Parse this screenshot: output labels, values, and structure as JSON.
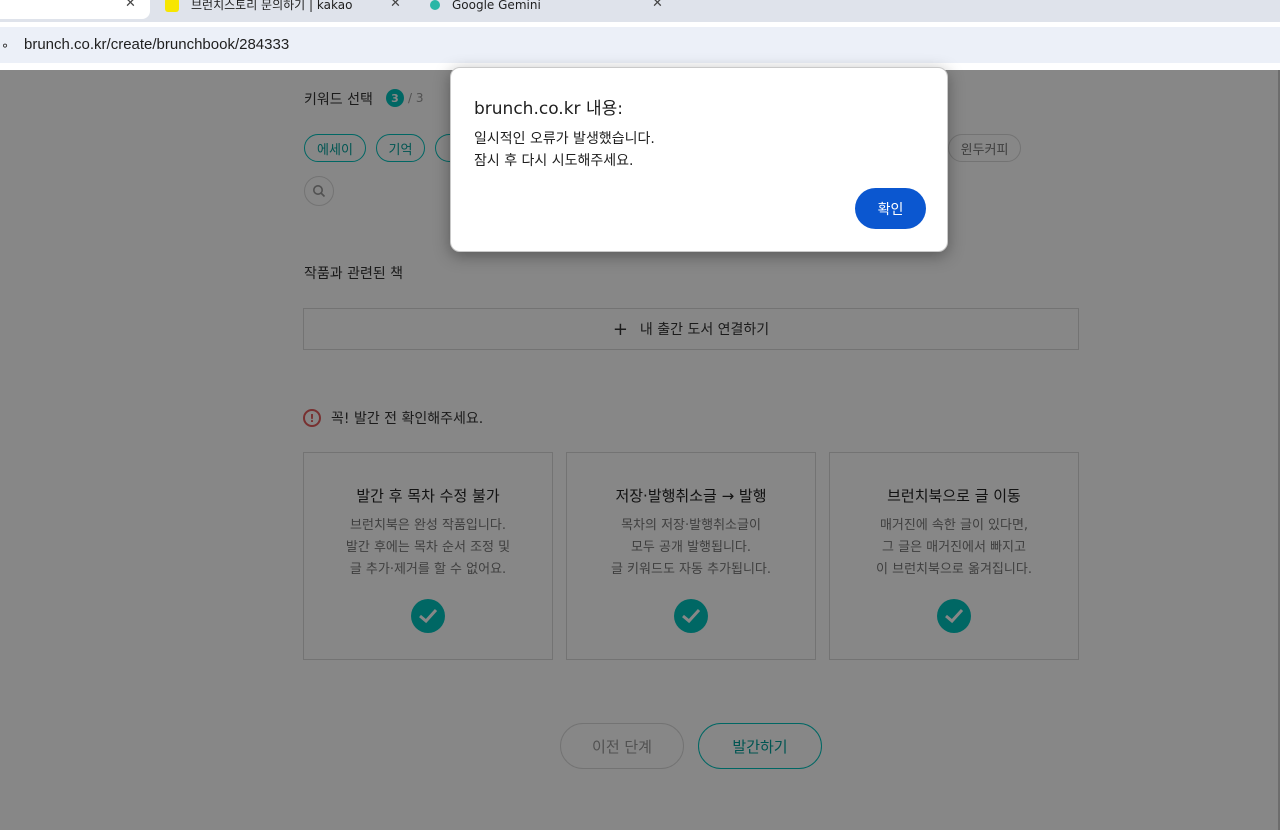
{
  "browser": {
    "tabs": [
      {
        "title": "",
        "active": true
      },
      {
        "title": "브런치스토리 문의하기 | kakao",
        "icon": "kakao-icon"
      },
      {
        "title": "Google Gemini",
        "icon": "gemini-icon"
      }
    ],
    "url": "brunch.co.kr/create/brunchbook/284333",
    "accent": "#0b57d0"
  },
  "keywords": {
    "title": "키워드 선택",
    "count_selected": "3",
    "count_total": "/ 3",
    "chips": [
      "에세이",
      "기억",
      "윈두커피"
    ]
  },
  "related_books": {
    "label": "작품과 관련된 책",
    "link_button": "내 출간 도서 연결하기"
  },
  "warning": {
    "text": "꼭! 발간 전 확인해주세요."
  },
  "cards": [
    {
      "title": "발간 후 목차 수정 불가",
      "lines": [
        "브런치북은 완성 작품입니다.",
        "발간 후에는 목차 순서 조정 및",
        "글 추가·제거를 할 수 없어요."
      ]
    },
    {
      "title": "저장·발행취소글 → 발행",
      "lines": [
        "목차의 저장·발행취소글이",
        "모두 공개 발행됩니다.",
        "글 키워드도 자동 추가됩니다."
      ]
    },
    {
      "title": "브런치북으로 글 이동",
      "lines": [
        "매거진에 속한 글이 있다면,",
        "그 글은 매거진에서 빠지고",
        "이 브런치북으로 옮겨집니다."
      ]
    }
  ],
  "actions": {
    "prev": "이전 단계",
    "publish": "발간하기"
  },
  "dialog": {
    "origin": "brunch.co.kr 내용:",
    "message_line1": "일시적인 오류가 발생했습니다.",
    "message_line2": "잠시 후 다시 시도해주세요.",
    "ok": "확인"
  },
  "colors": {
    "brand": "#00c3bd",
    "warning": "#e25c5c"
  }
}
